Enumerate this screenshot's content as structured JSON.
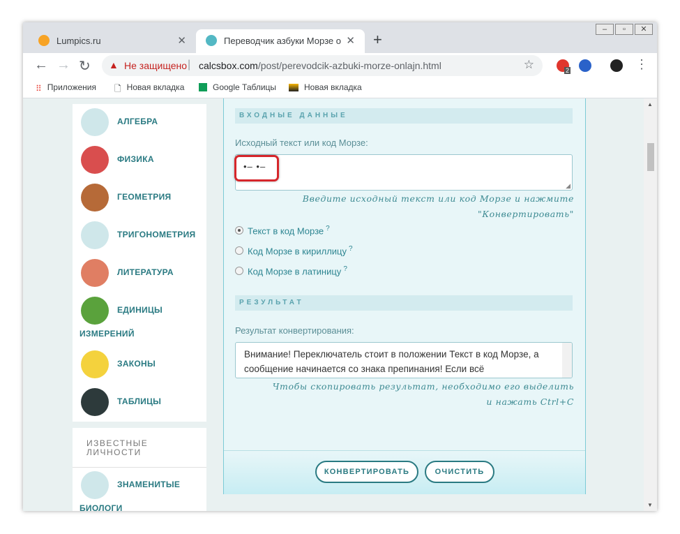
{
  "browser": {
    "tabs": [
      {
        "title": "Lumpics.ru",
        "active": false
      },
      {
        "title": "Переводчик азбуки Морзе онлайн",
        "active": true
      }
    ],
    "new_tab": "+",
    "security_label": "Не защищено",
    "url_host": "calcsbox.com",
    "url_path": "/post/perevodcik-azbuki-morze-onlajn.html",
    "extension_badge": "2",
    "bookmarks": [
      "Приложения",
      "Новая вкладка",
      "Google Таблицы",
      "Новая вкладка"
    ]
  },
  "sidebar": {
    "items": [
      {
        "label": "АЛГЕБРА",
        "color": "#cfe7ea",
        "icon": "algebra-icon"
      },
      {
        "label": "ФИЗИКА",
        "color": "#d94e4e",
        "icon": "atom-icon"
      },
      {
        "label": "ГЕОМЕТРИЯ",
        "color": "#b66a38",
        "icon": "ruler-icon"
      },
      {
        "label": "ТРИГОНОМЕТРИЯ",
        "color": "#cfe7ea",
        "icon": "compass-icon"
      },
      {
        "label": "ЛИТЕРАТУРА",
        "color": "#e07e63",
        "icon": "book-icon"
      },
      {
        "label": "ЕДИНИЦЫ",
        "label2": "ИЗМЕРЕНИЙ",
        "color": "#5aa23c",
        "icon": "scales-icon"
      },
      {
        "label": "ЗАКОНЫ",
        "color": "#f4d23d",
        "icon": "law-icon"
      },
      {
        "label": "ТАБЛИЦЫ",
        "color": "#2d3a3b",
        "icon": "table-icon"
      }
    ],
    "known_title": "ИЗВЕСТНЫЕ ЛИЧНОСТИ",
    "famous": {
      "label": "ЗНАМЕНИТЫЕ",
      "label2": "БИОЛОГИ",
      "color": "#cfe7ea",
      "icon": "clover-icon"
    }
  },
  "form": {
    "input_header": "ВХОДНЫЕ ДАННЫЕ",
    "input_label": "Исходный текст или код Морзе:",
    "input_value": "•– •–",
    "input_hint": "Введите исходный текст или код Морзе и нажмите \"Конвертировать\"",
    "options": [
      {
        "label": "Текст в код Морзе",
        "checked": true
      },
      {
        "label": "Код Морзе в кириллицу",
        "checked": false
      },
      {
        "label": "Код Морзе в латиницу",
        "checked": false
      }
    ],
    "help_mark": "?",
    "result_header": "РЕЗУЛЬТАТ",
    "result_label": "Результат конвертирования:",
    "result_value": "Внимание! Переключатель стоит в положении Текст в код Морзе, а сообщение начинается со знака препинания! Если всё",
    "result_hint": "Чтобы скопировать результат, необходимо его выделить и нажать Ctrl+C",
    "convert_button": "КОНВЕРТИРОВАТЬ",
    "clear_button": "ОЧИСТИТЬ"
  }
}
